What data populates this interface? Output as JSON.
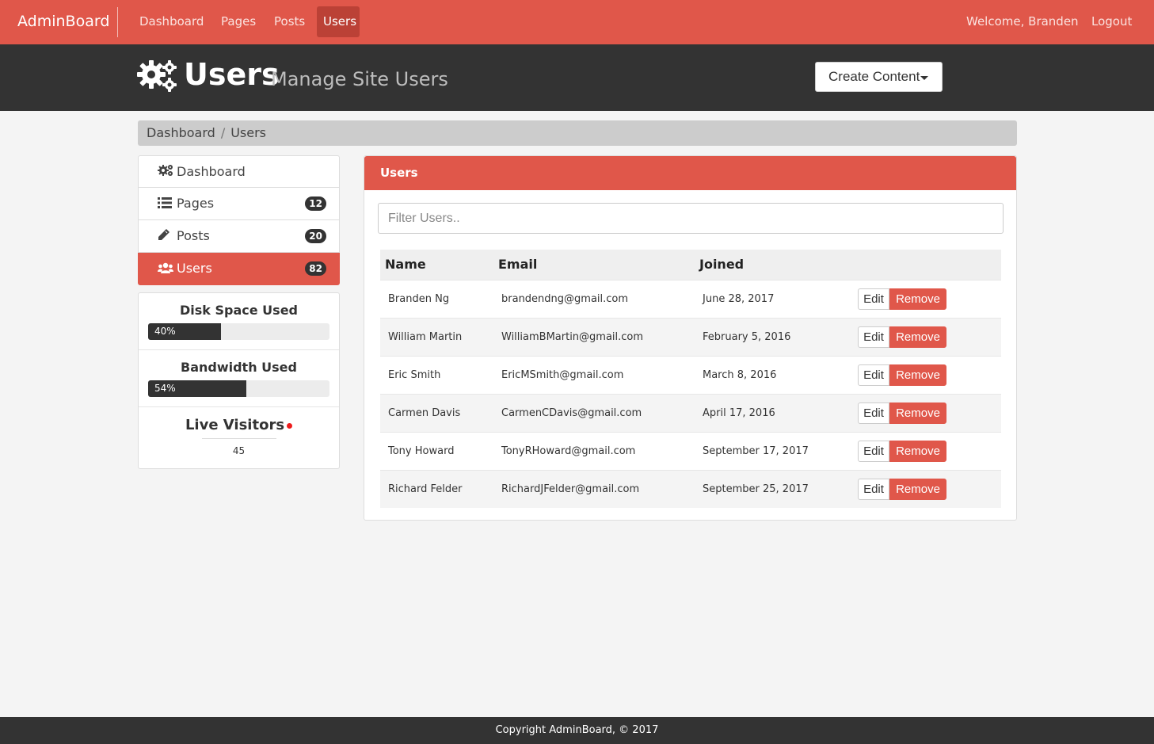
{
  "navbar": {
    "brand": "AdminBoard",
    "items": [
      {
        "label": "Dashboard"
      },
      {
        "label": "Pages"
      },
      {
        "label": "Posts"
      },
      {
        "label": "Users"
      }
    ],
    "welcome": "Welcome, Branden",
    "logout": "Logout"
  },
  "header": {
    "icon": "gears-icon",
    "title": "Users",
    "subtitle": "Manage Site Users",
    "create_button": "Create Content"
  },
  "breadcrumb": {
    "items": [
      "Dashboard",
      "Users"
    ],
    "separator": "/"
  },
  "sidebar": {
    "items": [
      {
        "label": "Dashboard",
        "icon": "gears-icon",
        "badge": ""
      },
      {
        "label": "Pages",
        "icon": "list-icon",
        "badge": "12"
      },
      {
        "label": "Posts",
        "icon": "pencil-icon",
        "badge": "20"
      },
      {
        "label": "Users",
        "icon": "users-icon",
        "badge": "82"
      }
    ],
    "disk": {
      "title": "Disk Space Used",
      "label": "40%",
      "value": 40
    },
    "bandwidth": {
      "title": "Bandwidth Used",
      "label": "54%",
      "value": 54
    },
    "live": {
      "title": "Live Visitors",
      "count": "45"
    }
  },
  "panel": {
    "title": "Users",
    "filter_placeholder": "Filter Users..",
    "columns": [
      "Name",
      "Email",
      "Joined"
    ],
    "edit_label": "Edit",
    "remove_label": "Remove",
    "rows": [
      {
        "name": "Branden Ng",
        "email": "brandendng@gmail.com",
        "joined": "June 28, 2017"
      },
      {
        "name": "William Martin",
        "email": "WilliamBMartin@gmail.com",
        "joined": "February 5, 2016"
      },
      {
        "name": "Eric Smith",
        "email": "EricMSmith@gmail.com",
        "joined": "March 8, 2016"
      },
      {
        "name": "Carmen Davis",
        "email": "CarmenCDavis@gmail.com",
        "joined": "April 17, 2016"
      },
      {
        "name": "Tony Howard",
        "email": "TonyRHoward@gmail.com",
        "joined": "September 17, 2017"
      },
      {
        "name": "Richard Felder",
        "email": "RichardJFelder@gmail.com",
        "joined": "September 25, 2017"
      }
    ]
  },
  "footer": {
    "text": "Copyright AdminBoard, © 2017"
  },
  "colors": {
    "accent": "#e0574a",
    "dark": "#333333",
    "active_nav": "#bb4136"
  }
}
